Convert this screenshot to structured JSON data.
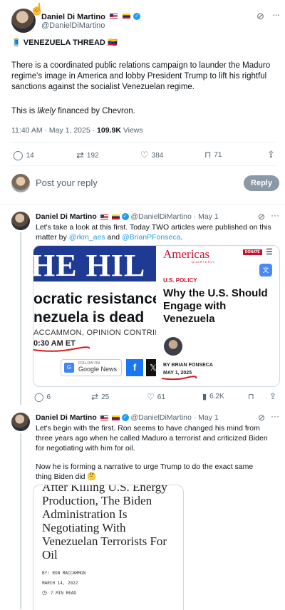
{
  "main_tweet": {
    "author_name": "Daniel Di Martino",
    "handle": "@DanielDiMartino",
    "title_emoji_left": "🧵",
    "title": "VENEZUELA THREAD",
    "title_emoji_right": "🇻🇪",
    "para1": "There is a coordinated public relations campaign to launder the Maduro regime's image in America and lobby President Trump to lift his rightful sanctions against the socialist Venezuelan regime.",
    "para2_prefix": "This is ",
    "para2_italic": "likely",
    "para2_suffix": " financed by Chevron.",
    "timestamp": "11:40 AM · May 1, 2025 · ",
    "views_count": "109.9K",
    "views_label": " Views",
    "replies": "14",
    "reposts": "192",
    "likes": "384",
    "bookmarks": "71"
  },
  "reply_box": {
    "placeholder": "Post your reply",
    "button_label": "Reply"
  },
  "reply1": {
    "author_name": "Daniel Di Martino",
    "handle": "@DanielDiMartino",
    "dot": " · ",
    "date": "May 1",
    "text_prefix": "Let's take a look at this first. Today TWO articles were published on this matter by ",
    "mention1": "@rkm_aes",
    "text_mid": " and ",
    "mention2": "@BrianPFonseca",
    "text_suffix": ".",
    "replies": "6",
    "reposts": "25",
    "likes": "61",
    "views": "6.2K",
    "left_image": {
      "masthead": "HE HIL",
      "headline_line1": "ocratic resistance",
      "headline_line2": "nezuela is dead",
      "byline": "ACCAMMON, OPINION CONTRIBUTO",
      "time": "0:30 AM ET",
      "follow_small": "FOLLOW ON",
      "follow_label": "Google News",
      "fb": "f"
    },
    "right_image": {
      "brand": "Americas",
      "brand_sub": "QUARTERLY",
      "donate": "DONATE",
      "section": "U.S. POLICY",
      "headline": "Why the U.S. Should Engage with Venezuela",
      "byline": "BY BRIAN FONSECA",
      "date": "MAY 1, 2025"
    }
  },
  "reply2": {
    "author_name": "Daniel Di Martino",
    "handle": "@DanielDiMartino",
    "dot": " · ",
    "date": "May 1",
    "para1": "Let's begin with the first. Ron seems to have changed his mind from three years ago when he called Maduro a terrorist and criticized Biden for negotiating with him for oil.",
    "para2": "Now he is forming a narrative to urge Trump to do the exact same thing Biden did 🤔",
    "image": {
      "headline_top": "After Killing U.S. Energy",
      "headline": "Production, The Biden Administration Is Negotiating With Venezuelan Terrorists For Oil",
      "byline": "BY: RON MACCAMMON",
      "date": "MARCH 14, 2022",
      "read_time": "7 MIN READ"
    }
  },
  "colors": {
    "accent": "#1d9bf0",
    "hill_red": "#1f3a93",
    "aq_red": "#c8102e"
  }
}
